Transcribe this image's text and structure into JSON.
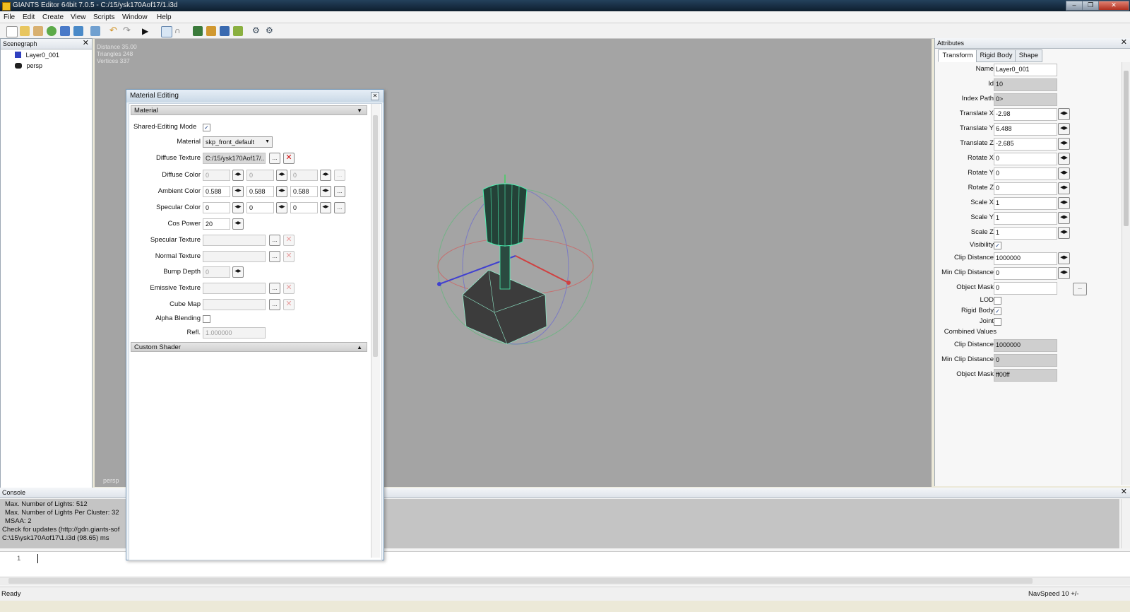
{
  "window": {
    "title": "GIANTS Editor 64bit 7.0.5 - C:/15/ysk170Aof17/1.i3d"
  },
  "menu": [
    "File",
    "Edit",
    "Create",
    "View",
    "Scripts",
    "Window",
    "Help"
  ],
  "toolbar": {
    "buttons": [
      "new-file-icon",
      "open-file-icon",
      "edit-icon",
      "refresh-icon",
      "save-icon",
      "save-as-icon",
      "import-icon",
      "undo-icon",
      "redo-icon",
      "play-icon",
      "select-tool-icon",
      "move-tool-icon",
      "terrain-tool-icon",
      "paint-tool-icon",
      "foliage-tool-icon",
      "brush-tool-icon",
      "settings-icon",
      "gear-icon"
    ]
  },
  "scenegraph": {
    "title": "Scenegraph",
    "items": [
      {
        "label": "Layer0_001",
        "icon": "cube-icon"
      },
      {
        "label": "persp",
        "icon": "camera-icon"
      }
    ]
  },
  "viewport": {
    "stats": [
      "Distance 35.00",
      "Triangles 248",
      "Vertices 337"
    ],
    "camera_label": "persp"
  },
  "material_dialog": {
    "title": "Material Editing",
    "section_material": "Material",
    "shared_editing_label": "Shared-Editing Mode",
    "shared_editing_checked": true,
    "material_label": "Material",
    "material_value": "skp_front_default",
    "diffuse_texture_label": "Diffuse Texture",
    "diffuse_texture_value": "C:/15/ysk170Aof17/...",
    "diffuse_color_label": "Diffuse Color",
    "diffuse_color": [
      "0",
      "0",
      "0"
    ],
    "ambient_color_label": "Ambient Color",
    "ambient_color": [
      "0.588",
      "0.588",
      "0.588"
    ],
    "specular_color_label": "Specular Color",
    "specular_color": [
      "0",
      "0",
      "0"
    ],
    "cos_power_label": "Cos Power",
    "cos_power": "20",
    "specular_texture_label": "Specular Texture",
    "normal_texture_label": "Normal Texture",
    "bump_depth_label": "Bump Depth",
    "bump_depth": "0",
    "emissive_texture_label": "Emissive Texture",
    "cube_map_label": "Cube Map",
    "alpha_blending_label": "Alpha Blending",
    "refl_label": "Refl.",
    "refl_value": "1.000000",
    "section_custom_shader": "Custom Shader",
    "browse_label": "...",
    "clear_label": "✕"
  },
  "attributes": {
    "title": "Attributes",
    "tabs": [
      "Transform",
      "Rigid Body",
      "Shape"
    ],
    "rows": [
      {
        "label": "Name",
        "value": "Layer0_001"
      },
      {
        "label": "Id",
        "value": "10"
      },
      {
        "label": "Index Path",
        "value": "0>"
      },
      {
        "label": "Translate X",
        "value": "-2.98"
      },
      {
        "label": "Translate Y",
        "value": "6.488"
      },
      {
        "label": "Translate Z",
        "value": "-2.685"
      },
      {
        "label": "Rotate X",
        "value": "0"
      },
      {
        "label": "Rotate Y",
        "value": "0"
      },
      {
        "label": "Rotate Z",
        "value": "0"
      },
      {
        "label": "Scale X",
        "value": "1"
      },
      {
        "label": "Scale Y",
        "value": "1"
      },
      {
        "label": "Scale Z",
        "value": "1"
      }
    ],
    "visibility_label": "Visibility",
    "clip_distance_label": "Clip Distance",
    "clip_distance": "1000000",
    "min_clip_distance_label": "Min Clip Distance",
    "min_clip_distance": "0",
    "object_mask_label": "Object Mask",
    "object_mask": "0",
    "lod_label": "LOD",
    "rigid_body_label": "Rigid Body",
    "joint_label": "Joint",
    "combined_values_label": "Combined Values",
    "combined_clip_distance": "1000000",
    "combined_min_clip_distance": "0",
    "combined_object_mask": "ff00ff"
  },
  "console": {
    "title": "Console",
    "lines": [
      "Max. Number of Lights: 512",
      "Max. Number of Lights Per Cluster: 32",
      "MSAA: 2",
      "Check for updates (http://gdn.giants-sof",
      "C:\\15\\ysk170Aof17\\1.i3d (98.65) ms"
    ],
    "line_number": "1"
  },
  "status": {
    "left": "Ready",
    "right": "NavSpeed 10 +/-"
  }
}
